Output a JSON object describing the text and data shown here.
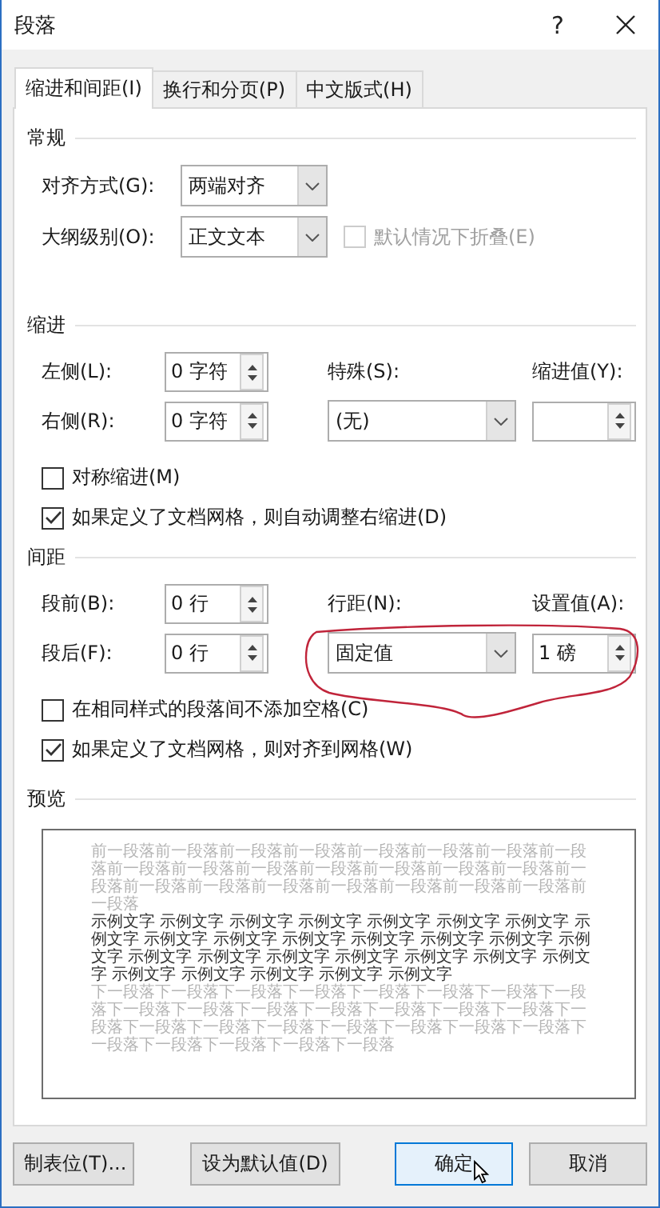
{
  "window": {
    "title": "段落",
    "help": "?"
  },
  "tabs": [
    {
      "label": "缩进和间距(I)",
      "selected": true
    },
    {
      "label": "换行和分页(P)",
      "selected": false
    },
    {
      "label": "中文版式(H)",
      "selected": false
    }
  ],
  "general": {
    "heading": "常规",
    "alignment": {
      "label": "对齐方式(G):",
      "value": "两端对齐"
    },
    "outline_level": {
      "label": "大纲级别(O):",
      "value": "正文文本"
    },
    "collapse": {
      "label": "默认情况下折叠(E)",
      "checked": false,
      "disabled": true
    }
  },
  "indentation": {
    "heading": "缩进",
    "left": {
      "label": "左侧(L):",
      "value": "0 字符"
    },
    "right": {
      "label": "右侧(R):",
      "value": "0 字符"
    },
    "special": {
      "label": "特殊(S):",
      "value": "(无)"
    },
    "by": {
      "label": "缩进值(Y):"
    },
    "checkboxes": [
      {
        "label": "对称缩进(M)",
        "checked": false
      },
      {
        "label": "如果定义了文档网格，则自动调整右缩进(D)",
        "checked": true
      }
    ]
  },
  "spacing": {
    "heading": "间距",
    "before": {
      "label": "段前(B):",
      "value": "0 行"
    },
    "after": {
      "label": "段后(F):",
      "value": "0 行"
    },
    "line_spacing": {
      "label": "行距(N):",
      "value": "固定值"
    },
    "at": {
      "label": "设置值(A):",
      "value": "1 磅"
    },
    "checkboxes": [
      {
        "label": "在相同样式的段落间不添加空格(C)",
        "checked": false
      },
      {
        "label": "如果定义了文档网格，则对齐到网格(W)",
        "checked": true
      }
    ]
  },
  "preview": {
    "heading": "预览",
    "previous_paragraph": "前一段落前一段落前一段落前一段落前一段落前一段落前一段落前一段落前一段落前一段落前一段落前一段落前一段落前一段落前一段落前一段落前一段落前一段落前一段落前一段落前一段落前一段落前一段落前一段落",
    "sample_text": "示例文字 示例文字 示例文字 示例文字 示例文字 示例文字 示例文字 示例文字 示例文字 示例文字 示例文字 示例文字 示例文字 示例文字 示例文字 示例文字 示例文字 示例文字 示例文字 示例文字 示例文字 示例文字 示例文字 示例文字 示例文字 示例文字 示例文字",
    "next_paragraph": "下一段落下一段落下一段落下一段落下一段落下一段落下一段落下一段落下一段落下一段落下一段落下一段落下一段落下一段落下一段落下一段落下一段落下一段落下一段落下一段落下一段落下一段落下一段落下一段落下一段落下一段落下一段落下一段落"
  },
  "buttons": [
    {
      "label": "制表位(T)...",
      "default": false
    },
    {
      "label": "设为默认值(D)",
      "default": false
    },
    {
      "label": "确定",
      "default": true
    },
    {
      "label": "取消",
      "default": false
    }
  ]
}
